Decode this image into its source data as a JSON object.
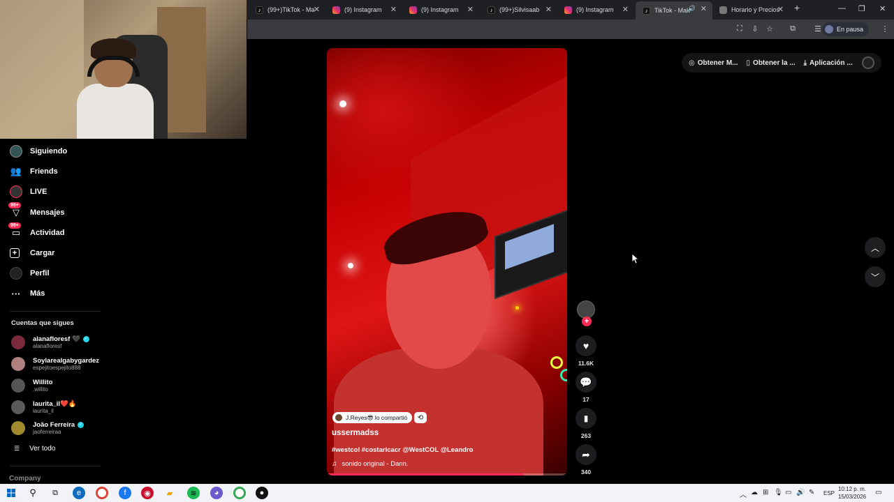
{
  "browser": {
    "tabs": [
      {
        "title": "(99+)TikTok - Ma",
        "favicon": "tiktok-icon"
      },
      {
        "title": "(9) Instagram",
        "favicon": "instagram-icon"
      },
      {
        "title": "(9) Instagram",
        "favicon": "instagram-icon"
      },
      {
        "title": "(99+)Silvisaab",
        "favicon": "tiktok-icon"
      },
      {
        "title": "(9) Instagram",
        "favicon": "instagram-icon"
      },
      {
        "title": "TikTok - Mak",
        "favicon": "tiktok-icon",
        "active": true
      },
      {
        "title": "Horario y Precios",
        "favicon": "generic-icon"
      }
    ],
    "new_tab": "+",
    "profile_status": "En pausa"
  },
  "sidebar": {
    "nav": [
      {
        "label": "Siguiendo",
        "icon": "following-icon"
      },
      {
        "label": "Friends",
        "icon": "friends-icon"
      },
      {
        "label": "LIVE",
        "icon": "live-icon"
      },
      {
        "label": "Mensajes",
        "icon": "messages-icon",
        "badge": "99+"
      },
      {
        "label": "Actividad",
        "icon": "activity-icon",
        "badge": "99+"
      },
      {
        "label": "Cargar",
        "icon": "upload-icon"
      },
      {
        "label": "Perfil",
        "icon": "profile-icon"
      },
      {
        "label": "Más",
        "icon": "more-icon"
      }
    ],
    "following_title": "Cuentas que sigues",
    "following": [
      {
        "name": "alanafloresf 🖤",
        "username": "alanafloresf",
        "verified": true,
        "avatar_color": "#7a2a3a"
      },
      {
        "name": "Soylarealgabygardez",
        "username": "espejitoespejito888",
        "verified": false,
        "avatar_color": "#b08080"
      },
      {
        "name": "Willito",
        "username": ".willito",
        "verified": false,
        "avatar_color": "#555555"
      },
      {
        "name": "laurita_il❤️🔥",
        "username": "laurita_il",
        "verified": false,
        "avatar_color": "#5a5a5a"
      },
      {
        "name": "João Ferreira",
        "username": "jaoferreiraa",
        "verified": true,
        "avatar_color": "#a08a30"
      }
    ],
    "see_all": "Ver todo",
    "company": "Company"
  },
  "top_actions": {
    "items": [
      "Obtener M...",
      "Obtener la ...",
      "Aplicación ..."
    ]
  },
  "video": {
    "shared_by": "J.Reyes😎 lo compartió",
    "author": "ussermadss",
    "caption": "#westcol #costaricacr @WestCOL @Leandro",
    "music": "sonido original - Dann.",
    "progress": 0.82
  },
  "actions": {
    "likes": "11.6K",
    "comments": "17",
    "saves": "263",
    "shares": "340"
  },
  "taskbar": {
    "language": "ESP",
    "time": "10:12 p. m.",
    "date": "15/03/2026"
  }
}
